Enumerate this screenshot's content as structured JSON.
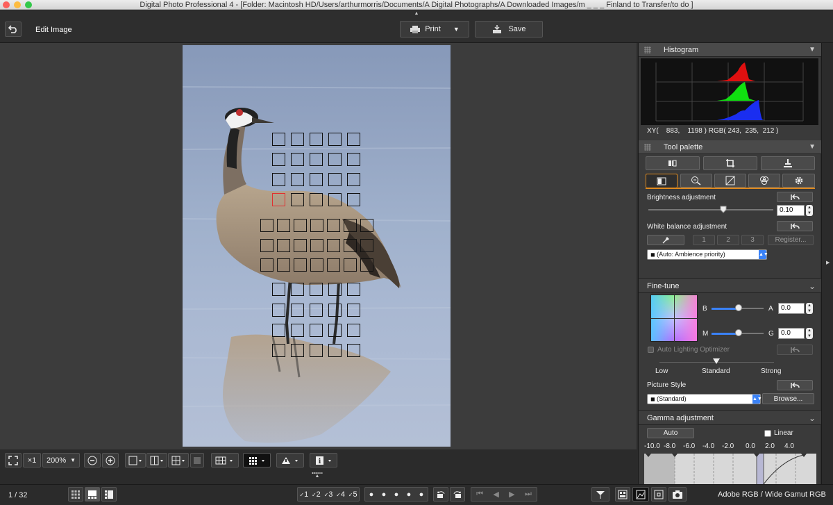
{
  "window": {
    "title": "Digital Photo Professional 4 - [Folder: Macintosh HD/Users/arthurmorris/Documents/A Digital Photographs/A Downloaded Images/m _ _ _ Finland to Transfer/to do ]"
  },
  "toolbar": {
    "mode_title": "Edit Image",
    "print_label": "Print",
    "save_label": "Save"
  },
  "viewer": {
    "zoom_x1": "×1",
    "zoom_level": "200%"
  },
  "histogram": {
    "title": "Histogram",
    "readout": "XY(    883,    1198 ) RGB( 243,  235,  212 )"
  },
  "tool_palette": {
    "title": "Tool palette",
    "brightness": {
      "label": "Brightness adjustment",
      "value": "0.10",
      "level": 0.6
    },
    "white_balance": {
      "label": "White balance adjustment",
      "slots": [
        "1",
        "2",
        "3"
      ],
      "register_label": "Register...",
      "selected": "(Auto: Ambience priority)"
    }
  },
  "fine_tune": {
    "title": "Fine-tune",
    "b_label": "B",
    "a_label": "A",
    "ba_value": "0.0",
    "m_label": "M",
    "g_label": "G",
    "mg_value": "0.0",
    "alo_label": "Auto Lighting Optimizer",
    "alo_low": "Low",
    "alo_standard": "Standard",
    "alo_strong": "Strong",
    "picture_style_label": "Picture Style",
    "picture_style_value": "(Standard)",
    "browse_label": "Browse..."
  },
  "gamma": {
    "title": "Gamma adjustment",
    "auto_label": "Auto",
    "linear_label": "Linear",
    "scale": [
      "-10.0",
      "-8.0",
      "-6.0",
      "-4.0",
      "-2.0",
      "0.0",
      "2.0",
      "4.0"
    ]
  },
  "status": {
    "page_counter": "1 / 32",
    "ratings": [
      "1",
      "2",
      "3",
      "4",
      "5"
    ],
    "color_space": "Adobe RGB / Wide Gamut RGB"
  },
  "colors": {
    "accent": "#3a82f7",
    "af_selected": "#e03030",
    "panel_bg": "#3a3a3a"
  }
}
